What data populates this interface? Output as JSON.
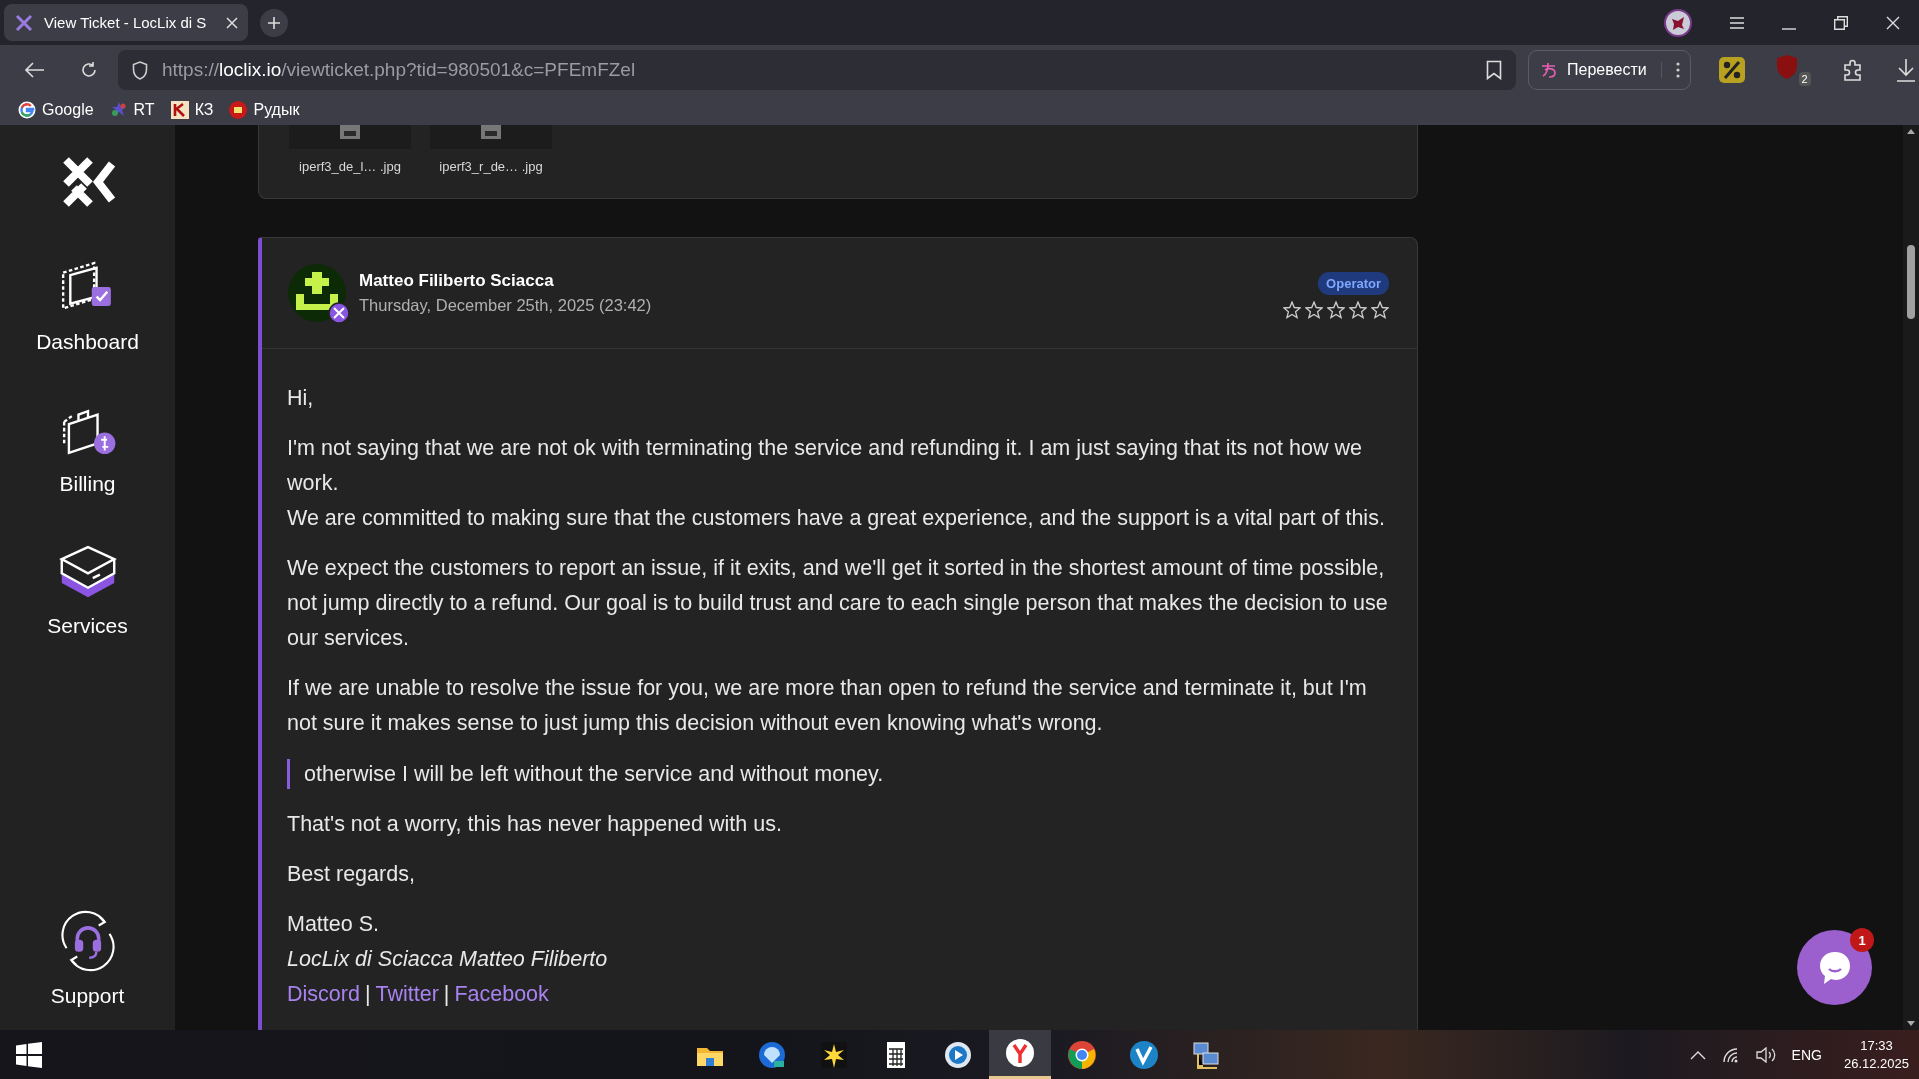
{
  "browser": {
    "tab": {
      "title": "View Ticket - LocLix di S",
      "selected": true
    },
    "url": {
      "scheme": "https://",
      "host": "loclix.io",
      "path": "/viewticket.php?tid=980501&c=PFEmFZel"
    },
    "translate_button": "Перевести",
    "extension_badge": "2",
    "bookmarks": [
      {
        "label": "Google",
        "kind": "google"
      },
      {
        "label": "RT",
        "kind": "rt"
      },
      {
        "label": "КЗ",
        "kind": "k"
      },
      {
        "label": "Рудык",
        "kind": "radio"
      }
    ]
  },
  "sidebar": {
    "items": [
      {
        "label": "Dashboard",
        "kind": "dashboard"
      },
      {
        "label": "Billing",
        "kind": "billing"
      },
      {
        "label": "Services",
        "kind": "services"
      },
      {
        "label": "Support",
        "kind": "support"
      }
    ]
  },
  "attachments": [
    {
      "name": "iperf3_de_l… .jpg"
    },
    {
      "name": "iperf3_r_de… .jpg"
    }
  ],
  "message": {
    "author": "Matteo Filiberto Sciacca",
    "date": "Thursday, December 25th, 2025 (23:42)",
    "badge": "Operator",
    "stars": 0,
    "body": [
      {
        "kind": "paragraph",
        "lines": [
          "Hi,"
        ]
      },
      {
        "kind": "paragraph",
        "lines": [
          "I'm not saying that we are not ok with terminating the service and refunding it. I am just saying that its not how we work.",
          "We are committed to making sure that the customers have a great experience, and the support is a vital part of this."
        ]
      },
      {
        "kind": "paragraph",
        "lines": [
          "We expect the customers to report an issue, if it exits, and we'll get it sorted in the shortest amount of time possible, not jump directly to a refund. Our goal is to build trust and care to each single person that makes the decision to use our services."
        ]
      },
      {
        "kind": "paragraph",
        "lines": [
          "If we are unable to resolve the issue for you, we are more than open to refund the service and terminate it, but I'm not sure it makes sense to just jump this decision without even knowing what's wrong."
        ]
      },
      {
        "kind": "quote",
        "lines": [
          "otherwise I will be left without the service and without money."
        ]
      },
      {
        "kind": "paragraph",
        "lines": [
          "That's not a worry, this has never happened with us."
        ]
      },
      {
        "kind": "paragraph",
        "lines": [
          "Best regards,"
        ]
      }
    ],
    "signature": {
      "name": "Matteo S.",
      "company": "LocLix di Sciacca Matteo Filiberto",
      "links": [
        {
          "kind": "link",
          "text": "Discord"
        },
        {
          "kind": "separator",
          "text": "|"
        },
        {
          "kind": "link",
          "text": "Twitter"
        },
        {
          "kind": "separator",
          "text": "|"
        },
        {
          "kind": "link",
          "text": "Facebook"
        }
      ]
    }
  },
  "chat": {
    "badge": "1"
  },
  "taskbar": {
    "apps": [
      {
        "kind": "folder",
        "selected": false
      },
      {
        "kind": "mail",
        "selected": false
      },
      {
        "kind": "star",
        "selected": false
      },
      {
        "kind": "calculator",
        "selected": false
      },
      {
        "kind": "player",
        "selected": false
      },
      {
        "kind": "yandex",
        "selected": true
      },
      {
        "kind": "chrome",
        "selected": false
      },
      {
        "kind": "vee",
        "selected": false
      },
      {
        "kind": "network",
        "selected": false
      }
    ],
    "tray": {
      "language": "ENG",
      "time": "17:33",
      "date": "26.12.2025"
    }
  }
}
